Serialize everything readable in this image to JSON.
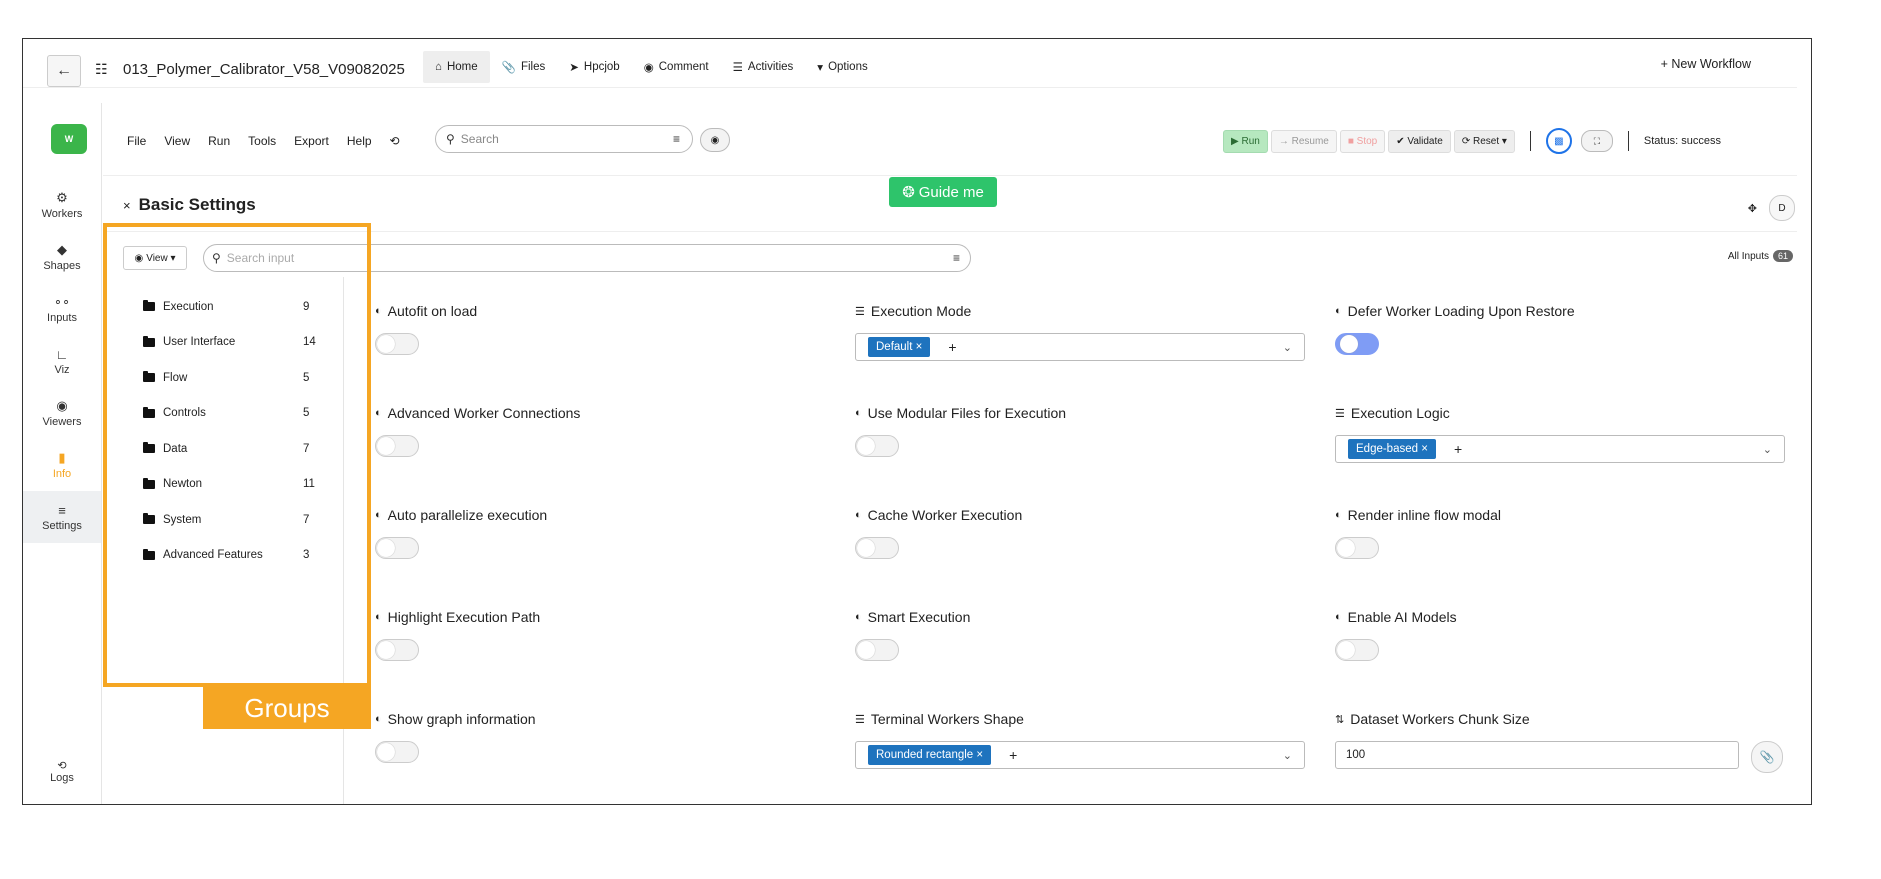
{
  "topbar": {
    "back_icon": "←",
    "workflow_title": "013_Polymer_Calibrator_V58_V09082025",
    "tabs": [
      {
        "label": "Home",
        "icon": "home-icon"
      },
      {
        "label": "Files",
        "icon": "paperclip-icon"
      },
      {
        "label": "Hpcjob",
        "icon": "rocket-icon"
      },
      {
        "label": "Comment",
        "icon": "comment-icon"
      },
      {
        "label": "Activities",
        "icon": "list-icon"
      },
      {
        "label": "Options",
        "icon": "caret-down-icon"
      }
    ],
    "new_workflow": "+ New Workflow"
  },
  "menubar": {
    "logo_text": "W",
    "items": [
      "File",
      "View",
      "Run",
      "Tools",
      "Export",
      "Help"
    ],
    "history_icon": "⟲",
    "search_placeholder": "Search",
    "run": "▶ Run",
    "resume": "→ Resume",
    "stop": "■ Stop",
    "validate": "Validate",
    "reset": "Reset ▾",
    "status": "Status: success"
  },
  "sidebar": {
    "items": [
      {
        "label": "Workers",
        "icon": "gear-icon"
      },
      {
        "label": "Shapes",
        "icon": "diamond-icon"
      },
      {
        "label": "Inputs",
        "icon": "inputs-icon"
      },
      {
        "label": "Viz",
        "icon": "chart-icon"
      },
      {
        "label": "Viewers",
        "icon": "eye-icon"
      },
      {
        "label": "Info",
        "icon": "file-icon"
      },
      {
        "label": "Settings",
        "icon": "sliders-icon"
      }
    ],
    "logs": "Logs"
  },
  "guide_label": "Guide me",
  "panel": {
    "title": "Basic Settings",
    "view_label": "View ▾",
    "search_placeholder": "Search input",
    "all_inputs_label": "All Inputs",
    "all_inputs_count": "61",
    "right_button": "D"
  },
  "groups": [
    {
      "label": "Execution",
      "count": "9"
    },
    {
      "label": "User Interface",
      "count": "14"
    },
    {
      "label": "Flow",
      "count": "5"
    },
    {
      "label": "Controls",
      "count": "5"
    },
    {
      "label": "Data",
      "count": "7"
    },
    {
      "label": "Newton",
      "count": "11"
    },
    {
      "label": "System",
      "count": "7"
    },
    {
      "label": "Advanced Features",
      "count": "3"
    }
  ],
  "groups_annotation": "Groups",
  "settings": {
    "autofit": "Autofit on load",
    "execution_mode": "Execution Mode",
    "execution_mode_value": "Default",
    "defer_loading": "Defer Worker Loading Upon Restore",
    "adv_connections": "Advanced Worker Connections",
    "modular_files": "Use Modular Files for Execution",
    "execution_logic": "Execution Logic",
    "execution_logic_value": "Edge-based",
    "auto_parallel": "Auto parallelize execution",
    "cache_exec": "Cache Worker Execution",
    "render_inline": "Render inline flow modal",
    "highlight_path": "Highlight Execution Path",
    "smart_exec": "Smart Execution",
    "enable_ai": "Enable AI Models",
    "show_graph": "Show graph information",
    "terminal_shape": "Terminal Workers Shape",
    "terminal_shape_value": "Rounded rectangle",
    "chunk_size": "Dataset Workers Chunk Size",
    "chunk_size_value": "100"
  },
  "colors": {
    "accent_green": "#2ec46b",
    "highlight_orange": "#f5a623",
    "chip_blue": "#1e73be",
    "toggle_on": "#7f9cf5"
  }
}
